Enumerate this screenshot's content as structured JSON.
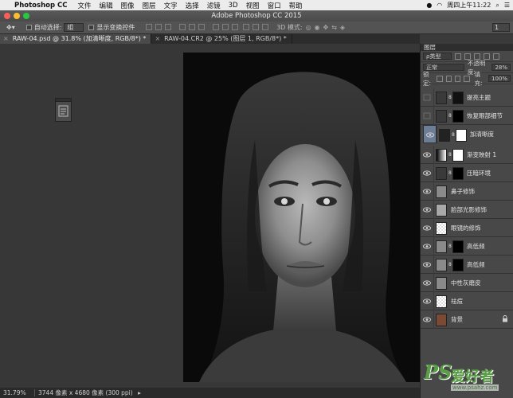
{
  "mac_menubar": {
    "app_name": "Photoshop CC",
    "items": [
      "文件",
      "编辑",
      "图像",
      "图层",
      "文字",
      "选择",
      "滤镜",
      "3D",
      "视图",
      "窗口",
      "帮助"
    ],
    "clock": "周四上午11:22"
  },
  "window": {
    "title": "Adobe Photoshop CC 2015"
  },
  "options_bar": {
    "auto_select_label": "自动选择:",
    "auto_select_value": "组",
    "transform_label": "显示变换控件",
    "mode_3d_label": "3D 模式:",
    "workspace_value": "1"
  },
  "tabs": [
    {
      "label": "RAW-04.psd @ 31.8% (加清晰度, RGB/8*) *",
      "active": true
    },
    {
      "label": "RAW-04.CR2 @ 25% (图层 1, RGB/8*) *",
      "active": false
    }
  ],
  "status": {
    "zoom": "31.79%",
    "doc_info": "3744 像素 x 4680 像素 (300 ppi)"
  },
  "layers_panel": {
    "tab_label": "图层",
    "filter_kind": "ρ类型",
    "blend_mode": "正常",
    "opacity_label": "不透明度:",
    "opacity_value": "28%",
    "lock_label": "锁定:",
    "fill_label": "填充:",
    "fill_value": "100%",
    "layers": [
      {
        "name": "提亮主题",
        "visible": false,
        "selected": false
      },
      {
        "name": "恢复眼部细节",
        "visible": false,
        "selected": false
      },
      {
        "name": "加清晰度",
        "visible": true,
        "selected": true
      },
      {
        "name": "渐变映射 1",
        "visible": true,
        "selected": false
      },
      {
        "name": "压暗环境",
        "visible": true,
        "selected": false
      },
      {
        "name": "鼻子修饰",
        "visible": true,
        "selected": false
      },
      {
        "name": "脸部光影修饰",
        "visible": true,
        "selected": false
      },
      {
        "name": "眼镜的修饰",
        "visible": true,
        "selected": false
      },
      {
        "name": "高低频",
        "visible": true,
        "selected": false
      },
      {
        "name": "高低频",
        "visible": true,
        "selected": false
      },
      {
        "name": "中性灰磨皮",
        "visible": true,
        "selected": false
      },
      {
        "name": "祛痘",
        "visible": true,
        "selected": false
      },
      {
        "name": "背景",
        "visible": true,
        "selected": false
      }
    ]
  },
  "watermark": {
    "logo": "PS",
    "site_name": "爱好者",
    "url": "www.psahz.com"
  },
  "colors": {
    "selected_layer": "#6c7d96",
    "panel_bg": "#484848",
    "canvas_bg": "#373737",
    "watermark_green": "#5a9e46"
  }
}
